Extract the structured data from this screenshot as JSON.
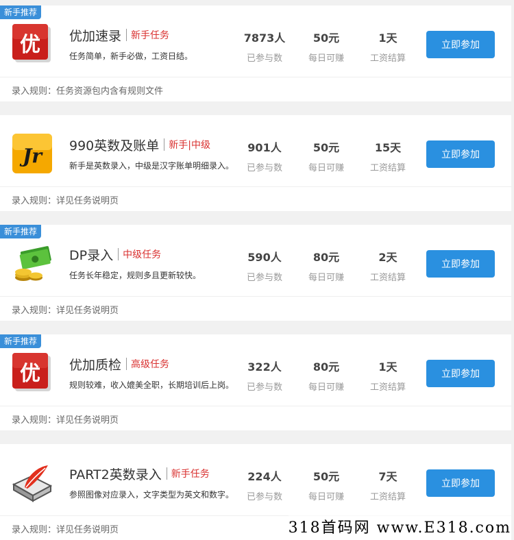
{
  "tasks": [
    {
      "badge": "新手推荐",
      "icon": "youjia-red-logo-icon",
      "name": "优加速录",
      "level": "新手任务",
      "desc": "任务简单，新手必做，工资日结。",
      "participants": "7873人",
      "participants_label": "已参与数",
      "daily": "50元",
      "daily_label": "每日可赚",
      "settle": "1天",
      "settle_label": "工资结算",
      "button": "立即参加",
      "rule": "录入规则：任务资源包内含有规则文件"
    },
    {
      "badge": "",
      "icon": "jr-yellow-logo-icon",
      "name": "990英数及账单",
      "level": "新手|中级",
      "desc": "新手是英数录入，中级是汉字账单明细录入。",
      "participants": "901人",
      "participants_label": "已参与数",
      "daily": "50元",
      "daily_label": "每日可赚",
      "settle": "15天",
      "settle_label": "工资结算",
      "button": "立即参加",
      "rule": "录入规则：详见任务说明页"
    },
    {
      "badge": "新手推荐",
      "icon": "money-coins-icon",
      "name": "DP录入",
      "level": "中级任务",
      "desc": "任务长年稳定，规则多且更新较快。",
      "participants": "590人",
      "participants_label": "已参与数",
      "daily": "80元",
      "daily_label": "每日可赚",
      "settle": "2天",
      "settle_label": "工资结算",
      "button": "立即参加",
      "rule": "录入规则：详见任务说明页"
    },
    {
      "badge": "新手推荐",
      "icon": "youjia-red-logo-icon",
      "name": "优加质检",
      "level": "高级任务",
      "desc": "规则较难，收入媲美全职，长期培训后上岗。",
      "participants": "322人",
      "participants_label": "已参与数",
      "daily": "80元",
      "daily_label": "每日可赚",
      "settle": "1天",
      "settle_label": "工资结算",
      "button": "立即参加",
      "rule": "录入规则：详见任务说明页"
    },
    {
      "badge": "",
      "icon": "quill-disk-icon",
      "name": "PART2英数录入",
      "level": "新手任务",
      "desc": "参照图像对应录入，文字类型为英文和数字。",
      "participants": "224人",
      "participants_label": "已参与数",
      "daily": "50元",
      "daily_label": "每日可赚",
      "settle": "7天",
      "settle_label": "工资结算",
      "button": "立即参加",
      "rule": "录入规则：详见任务说明页"
    }
  ],
  "watermark": "318首码网 www.E318.com",
  "colors": {
    "accent": "#2a90e0",
    "badge": "#3a8fd9",
    "level": "#d9302f"
  }
}
